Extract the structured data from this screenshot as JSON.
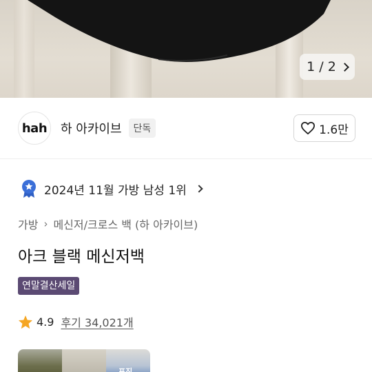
{
  "gallery": {
    "pager_text": "1 / 2"
  },
  "brand": {
    "logo_text": "hah",
    "name": "하 아카이브",
    "badge": "단독",
    "like_count": "1.6만"
  },
  "ranking": {
    "text": "2024년 11월 가방 남성 1위"
  },
  "breadcrumb": {
    "items": [
      "가방",
      "메신저/크로스 백 (하 아카이브)"
    ]
  },
  "product": {
    "title": "아크 블랙 메신저백",
    "sale_badge": "연말결산세일",
    "rating": "4.9",
    "reviews": "후기 34,021개"
  },
  "thumbnails": {
    "partial_label": "포진"
  },
  "colors": {
    "sale_badge": "#5b4a73",
    "star": "#f5a623",
    "rank_badge": "#3b6fd8"
  }
}
